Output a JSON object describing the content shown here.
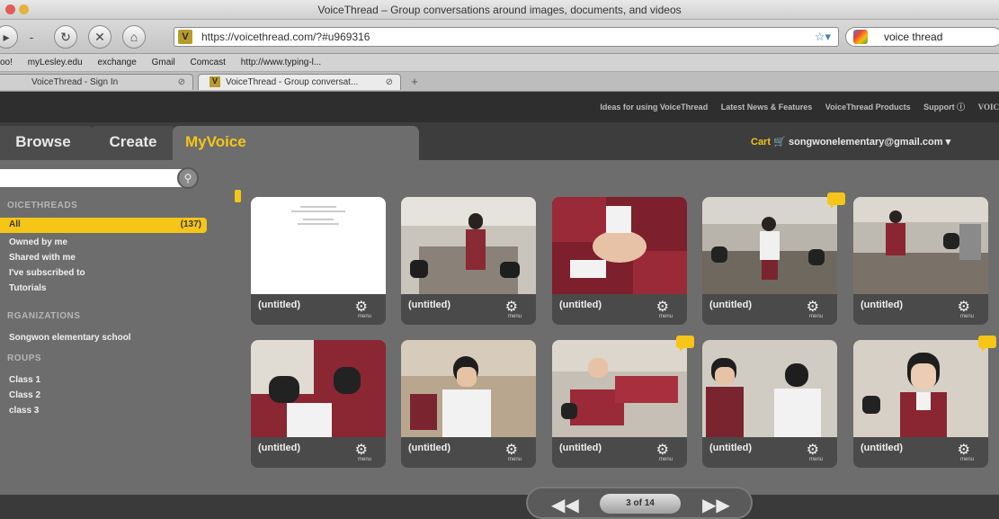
{
  "window": {
    "title": "VoiceThread – Group conversations around images, documents, and videos",
    "colors": {
      "close": "#e35c55",
      "minimize": "#e3b33f",
      "zoom": "#7cbf4c"
    }
  },
  "toolbar": {
    "url": "https://voicethread.com/?#u969316",
    "search_value": "voice thread",
    "icons": [
      "back-icon",
      "forward-icon",
      "reload-icon",
      "stop-icon",
      "home-icon"
    ]
  },
  "bookmarks": [
    "oo!",
    "myLesley.edu",
    "exchange",
    "Gmail",
    "Comcast",
    "http://www.typing-l..."
  ],
  "browser_tabs": [
    {
      "label": "VoiceThread - Sign In",
      "active": false
    },
    {
      "label": "VoiceThread - Group conversat...",
      "active": true
    }
  ],
  "site_links": [
    "Ideas for using VoiceThread",
    "Latest News & Features",
    "VoiceThread Products",
    "Support ⓘ",
    "VOIC"
  ],
  "main_tabs": [
    "Browse",
    "Create",
    "MyVoice"
  ],
  "header": {
    "cart": "Cart",
    "account": "songwonelementary@gmail.com"
  },
  "sidebar": {
    "voicethreads_head": "OICETHREADS",
    "all_label": "All",
    "all_count": "(137)",
    "voicethreads": [
      "Owned by me",
      "Shared with me",
      "I've subscribed to",
      "Tutorials"
    ],
    "organizations_head": "RGANIZATIONS",
    "organizations": [
      "Songwon elementary school"
    ],
    "groups_head": "ROUPS",
    "groups": [
      "Class 1",
      "Class 2",
      "class 3"
    ]
  },
  "cards": [
    {
      "title": "(untitled)",
      "menu": "menu",
      "thumb": "doc",
      "comment": false
    },
    {
      "title": "(untitled)",
      "menu": "menu",
      "thumb": "classroom-a",
      "comment": false
    },
    {
      "title": "(untitled)",
      "menu": "menu",
      "thumb": "hands",
      "comment": false
    },
    {
      "title": "(untitled)",
      "menu": "menu",
      "thumb": "classroom-b",
      "comment": true
    },
    {
      "title": "(untitled)",
      "menu": "menu",
      "thumb": "classroom-c",
      "comment": false
    },
    {
      "title": "(untitled)",
      "menu": "menu",
      "thumb": "kids-a",
      "comment": false
    },
    {
      "title": "(untitled)",
      "menu": "menu",
      "thumb": "boy-a",
      "comment": false
    },
    {
      "title": "(untitled)",
      "menu": "menu",
      "thumb": "arms",
      "comment": true
    },
    {
      "title": "(untitled)",
      "menu": "menu",
      "thumb": "boys-b",
      "comment": false
    },
    {
      "title": "(untitled)",
      "menu": "menu",
      "thumb": "girl-a",
      "comment": true
    }
  ],
  "pagination": {
    "label": "3 of 14"
  },
  "accent_color": "#f5c518"
}
